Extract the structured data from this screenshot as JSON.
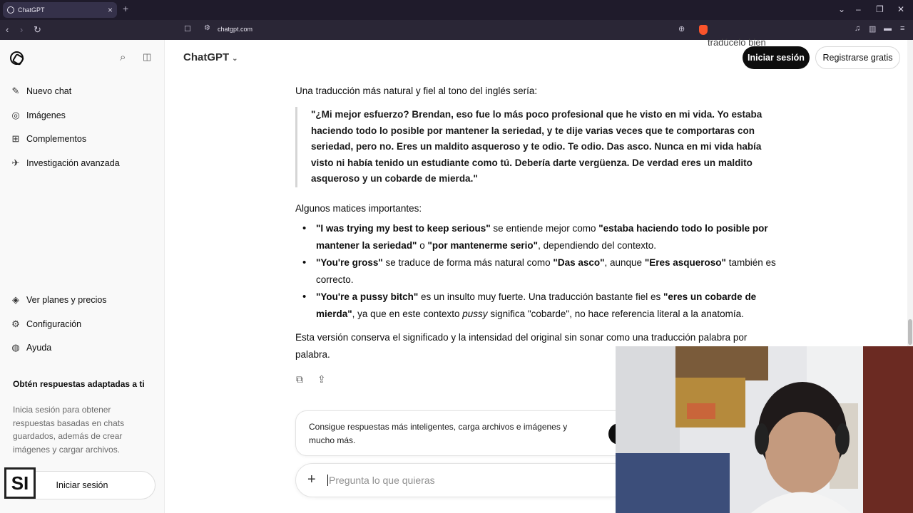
{
  "browser": {
    "tab_title": "ChatGPT",
    "tab_close": "×",
    "new_tab": "+",
    "url": "chatgpt.com"
  },
  "header": {
    "model": "ChatGPT",
    "model_chevron": "⌄",
    "partial_text": "tradúcelo bien",
    "login": "Iniciar sesión",
    "register": "Registrarse gratis"
  },
  "sidebar": {
    "items": [
      {
        "label": "Nuevo chat",
        "icon": "edit-icon"
      },
      {
        "label": "Imágenes",
        "icon": "image-icon"
      },
      {
        "label": "Complementos",
        "icon": "grid-icon"
      },
      {
        "label": "Investigación avanzada",
        "icon": "telescope-icon"
      }
    ],
    "bottom_items": [
      {
        "label": "Ver planes y precios",
        "icon": "plans-icon"
      },
      {
        "label": "Configuración",
        "icon": "gear-icon"
      },
      {
        "label": "Ayuda",
        "icon": "help-icon"
      }
    ],
    "promo_title": "Obtén respuestas adaptadas a ti",
    "promo_text": "Inicia sesión para obtener respuestas basadas en chats guardados, además de crear imágenes y cargar archivos.",
    "login": "Iniciar sesión",
    "watermark": "SI"
  },
  "content": {
    "intro": "Una traducción más natural y fiel al tono del inglés sería:",
    "quote": "\"¿Mi mejor esfuerzo? Brendan, eso fue lo más poco profesional que he visto en mi vida. Yo estaba haciendo todo lo posible por mantener la seriedad, y te dije varias veces que te comportaras con seriedad, pero no. Eres un maldito asqueroso y te odio. Te odio. Das asco. Nunca en mi vida había visto ni había tenido un estudiante como tú. Debería darte vergüenza. De verdad eres un maldito asqueroso y un cobarde de mierda.\"",
    "notes_title": "Algunos matices importantes:",
    "b1_en": "\"I was trying my best to keep serious\"",
    "b1_mid": " se entiende mejor como ",
    "b1_es1": "\"estaba haciendo todo lo posible por mantener la seriedad\"",
    "b1_o": " o ",
    "b1_es2": "\"por mantenerme serio\"",
    "b1_end": ", dependiendo del contexto.",
    "b2_en": "\"You're gross\"",
    "b2_mid": " se traduce de forma más natural como ",
    "b2_es1": "\"Das asco\"",
    "b2_aun": ", aunque ",
    "b2_es2": "\"Eres asqueroso\"",
    "b2_end": " también es correcto.",
    "b3_en": "\"You're a pussy bitch\"",
    "b3_mid": " es un insulto muy fuerte. Una traducción bastante fiel es ",
    "b3_es": "\"eres un cobarde de mierda\"",
    "b3_ctx": ", ya que en este contexto ",
    "b3_word": "pussy",
    "b3_end": " significa \"cobarde\", no hace referencia literal a la anatomía.",
    "closing": "Esta versión conserva el significado y la intensidad del original sin sonar como una traducción palabra por palabra."
  },
  "composer": {
    "upsell": "Consigue respuestas más inteligentes, carga archivos e imágenes y mucho más.",
    "plus": "+",
    "placeholder": "Pregunta lo que quieras"
  }
}
